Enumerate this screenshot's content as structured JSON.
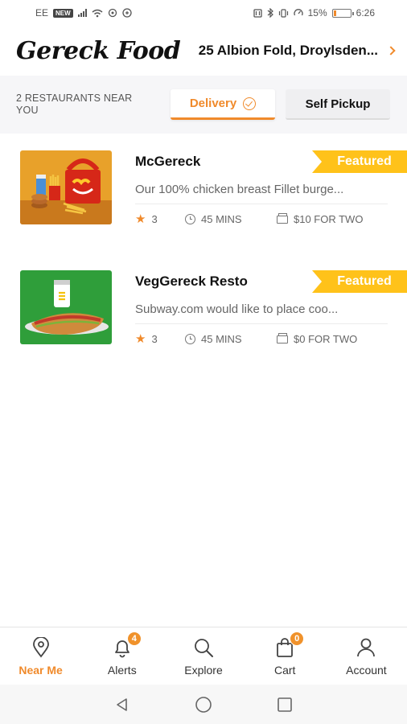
{
  "status_bar": {
    "carrier": "EE",
    "carrier_badge": "NEW",
    "battery_percent": "15%",
    "time": "6:26",
    "battery_level": 0.15
  },
  "header": {
    "logo": "Gereck Food",
    "address": "25 Albion Fold, Droylsden..."
  },
  "filter": {
    "near_count": "2 RESTAURANTS NEAR YOU",
    "tabs": [
      {
        "label": "Delivery",
        "active": true
      },
      {
        "label": "Self Pickup",
        "active": false
      }
    ]
  },
  "restaurants": [
    {
      "name": "McGereck",
      "badge": "Featured",
      "description": "Our 100% chicken breast Fillet burge...",
      "rating": "3",
      "time": "45 MINS",
      "price": "$10 FOR TWO"
    },
    {
      "name": "VegGereck Resto",
      "badge": "Featured",
      "description": "Subway.com would like to place coo...",
      "rating": "3",
      "time": "45 MINS",
      "price": "$0 FOR TWO"
    }
  ],
  "bottom_nav": [
    {
      "label": "Near Me",
      "icon": "location-pin-icon",
      "active": true
    },
    {
      "label": "Alerts",
      "icon": "bell-icon",
      "badge": "4"
    },
    {
      "label": "Explore",
      "icon": "search-icon"
    },
    {
      "label": "Cart",
      "icon": "shopping-bag-icon",
      "badge": "0"
    },
    {
      "label": "Account",
      "icon": "user-icon"
    }
  ],
  "colors": {
    "accent": "#f08a2b",
    "featured": "#ffc21a"
  }
}
